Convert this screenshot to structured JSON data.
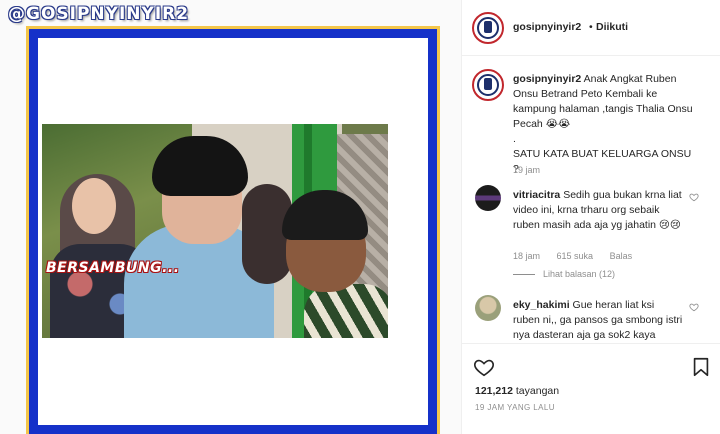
{
  "watermark": "@GOSIPNYINYIR2",
  "video": {
    "caption": "BERSAMBUNG..."
  },
  "header": {
    "username": "gosipnyinyir2",
    "separator": "•",
    "follow_status": "Diikuti"
  },
  "caption": {
    "username": "gosipnyinyir2",
    "text_line1": "Anak Angkat Ruben Onsu Betrand Peto Kembali ke kampung halaman ,tangis Thalia Onsu Pecah 😭😭",
    "text_line2": ".",
    "text_line3": "SATU KATA BUAT KELUARGA ONSU ?",
    "time": "19 jam"
  },
  "comments": [
    {
      "username": "vitriacitra",
      "text": "Sedih gua bukan krna liat video ini, krna trharu org sebaik ruben masih ada aja yg jahatin 😢😢",
      "time": "18 jam",
      "likes": "615 suka",
      "reply": "Balas",
      "view_replies": "Lihat balasan (12)"
    },
    {
      "username": "eky_hakimi",
      "text": "Gue heran liat ksi ruben ni,, ga pansos ga smbong istri nya dasteran aja ga sok2 kaya pdhal beneran kaya raya. msih ada"
    }
  ],
  "actions": {
    "views_count": "121,212",
    "views_label": "tayangan",
    "time_ago": "19 JAM YANG LALU"
  },
  "colors": {
    "frame_yellow": "#f4c64a",
    "frame_blue": "#1531c9",
    "text_primary": "#262626",
    "text_secondary": "#8e8e8e"
  }
}
